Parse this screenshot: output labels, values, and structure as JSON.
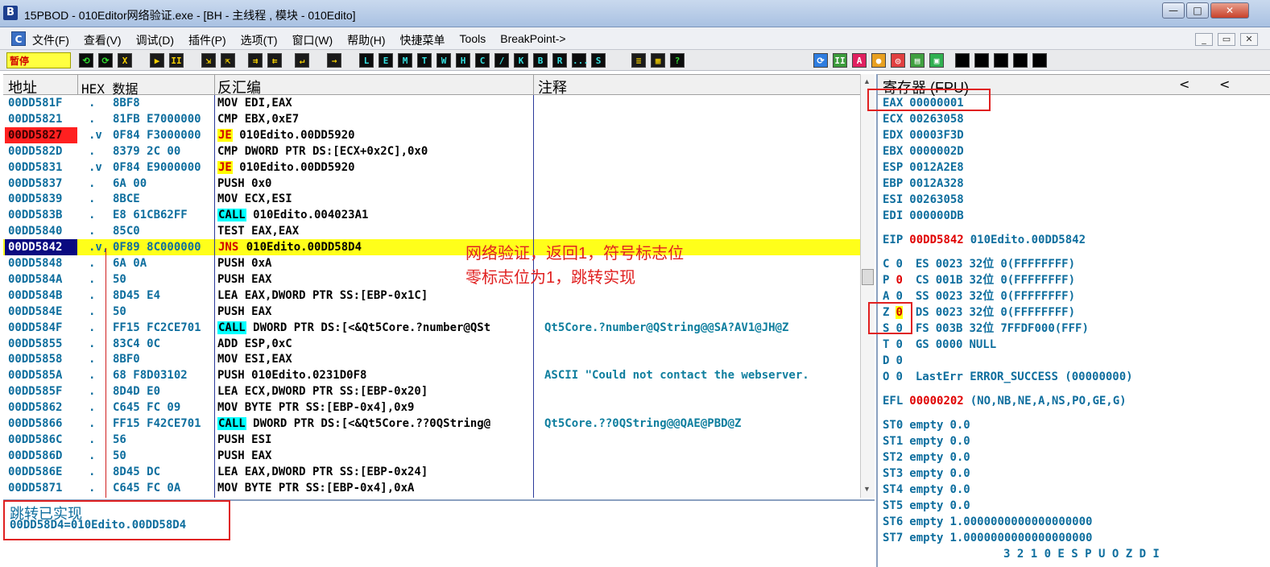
{
  "window": {
    "title": "15PBOD  - 010Editor网络验证.exe - [BH - 主线程 , 模块 - 010Edito]",
    "controls": [
      "—",
      "□",
      "✕"
    ]
  },
  "menu": {
    "items": [
      "文件(F)",
      "查看(V)",
      "调试(D)",
      "插件(P)",
      "选项(T)",
      "窗口(W)",
      "帮助(H)",
      "快捷菜单",
      "Tools",
      "BreakPoint->"
    ],
    "mdi_controls": [
      "_",
      "▭",
      "✕"
    ]
  },
  "toolbar": {
    "status": "暂停",
    "buttons": [
      "⟲",
      "⟳",
      "X",
      "▶",
      "II",
      "⇲",
      "⇱",
      "⇉",
      "⇇",
      "↵",
      "→",
      "L",
      "E",
      "M",
      "T",
      "W",
      "H",
      "C",
      "/",
      "K",
      "B",
      "R",
      "...",
      "S",
      "≡",
      "▦",
      "?"
    ]
  },
  "disasm": {
    "headers": {
      "address": "地址",
      "hex": "HEX 数据",
      "disasm": "反汇编",
      "comment": "注释"
    },
    "rows": [
      {
        "addr": "00DD581F",
        "arrow": ".",
        "hex": "8BF8",
        "op": "",
        "dis": "MOV EDI,EAX",
        "comment": "",
        "type": ""
      },
      {
        "addr": "00DD5821",
        "arrow": ".",
        "hex": "81FB E7000000",
        "op": "",
        "dis": "CMP EBX,0xE7",
        "comment": "",
        "type": ""
      },
      {
        "addr": "00DD5827",
        "arrow": ".v",
        "hex": "0F84 F3000000",
        "op": "JE",
        "dis": " 010Edito.00DD5920",
        "comment": "",
        "type": "bp"
      },
      {
        "addr": "00DD582D",
        "arrow": ".",
        "hex": "8379 2C 00",
        "op": "",
        "dis": "CMP DWORD PTR DS:[ECX+0x2C],0x0",
        "comment": "",
        "type": ""
      },
      {
        "addr": "00DD5831",
        "arrow": ".v",
        "hex": "0F84 E9000000",
        "op": "JE",
        "dis": " 010Edito.00DD5920",
        "comment": "",
        "type": ""
      },
      {
        "addr": "00DD5837",
        "arrow": ".",
        "hex": "6A 00",
        "op": "",
        "dis": "PUSH 0x0",
        "comment": "",
        "type": ""
      },
      {
        "addr": "00DD5839",
        "arrow": ".",
        "hex": "8BCE",
        "op": "",
        "dis": "MOV ECX,ESI",
        "comment": "",
        "type": ""
      },
      {
        "addr": "00DD583B",
        "arrow": ".",
        "hex": "E8 61CB62FF",
        "op": "CALL",
        "dis": " 010Edito.004023A1",
        "comment": "",
        "type": ""
      },
      {
        "addr": "00DD5840",
        "arrow": ".",
        "hex": "85C0",
        "op": "",
        "dis": "TEST EAX,EAX",
        "comment": "",
        "type": ""
      },
      {
        "addr": "00DD5842",
        "arrow": ".v,",
        "hex": "0F89 8C000000",
        "op": "JNS",
        "dis": " 010Edito.00DD58D4",
        "comment": "",
        "type": "eip"
      },
      {
        "addr": "00DD5848",
        "arrow": ".",
        "hex": "6A 0A",
        "op": "",
        "dis": "PUSH 0xA",
        "comment": "",
        "type": ""
      },
      {
        "addr": "00DD584A",
        "arrow": ".",
        "hex": "50",
        "op": "",
        "dis": "PUSH EAX",
        "comment": "",
        "type": ""
      },
      {
        "addr": "00DD584B",
        "arrow": ".",
        "hex": "8D45 E4",
        "op": "",
        "dis": "LEA EAX,DWORD PTR SS:[EBP-0x1C]",
        "comment": "",
        "type": ""
      },
      {
        "addr": "00DD584E",
        "arrow": ".",
        "hex": "50",
        "op": "",
        "dis": "PUSH EAX",
        "comment": "",
        "type": ""
      },
      {
        "addr": "00DD584F",
        "arrow": ".",
        "hex": "FF15 FC2CE701",
        "op": "CALL",
        "dis": " DWORD PTR DS:[<&Qt5Core.?number@QSt",
        "comment": "Qt5Core.?number@QString@@SA?AV1@JH@Z",
        "type": ""
      },
      {
        "addr": "00DD5855",
        "arrow": ".",
        "hex": "83C4 0C",
        "op": "",
        "dis": "ADD ESP,0xC",
        "comment": "",
        "type": ""
      },
      {
        "addr": "00DD5858",
        "arrow": ".",
        "hex": "8BF0",
        "op": "",
        "dis": "MOV ESI,EAX",
        "comment": "",
        "type": ""
      },
      {
        "addr": "00DD585A",
        "arrow": ".",
        "hex": "68 F8D03102",
        "op": "",
        "dis": "PUSH 010Edito.0231D0F8",
        "comment": "ASCII \"Could not contact the webserver.",
        "type": ""
      },
      {
        "addr": "00DD585F",
        "arrow": ".",
        "hex": "8D4D E0",
        "op": "",
        "dis": "LEA ECX,DWORD PTR SS:[EBP-0x20]",
        "comment": "",
        "type": ""
      },
      {
        "addr": "00DD5862",
        "arrow": ".",
        "hex": "C645 FC 09",
        "op": "",
        "dis": "MOV BYTE PTR SS:[EBP-0x4],0x9",
        "comment": "",
        "type": ""
      },
      {
        "addr": "00DD5866",
        "arrow": ".",
        "hex": "FF15 F42CE701",
        "op": "CALL",
        "dis": " DWORD PTR DS:[<&Qt5Core.??0QString@",
        "comment": "Qt5Core.??0QString@@QAE@PBD@Z",
        "type": ""
      },
      {
        "addr": "00DD586C",
        "arrow": ".",
        "hex": "56",
        "op": "",
        "dis": "PUSH ESI",
        "comment": "",
        "type": ""
      },
      {
        "addr": "00DD586D",
        "arrow": ".",
        "hex": "50",
        "op": "",
        "dis": "PUSH EAX",
        "comment": "",
        "type": ""
      },
      {
        "addr": "00DD586E",
        "arrow": ".",
        "hex": "8D45 DC",
        "op": "",
        "dis": "LEA EAX,DWORD PTR SS:[EBP-0x24]",
        "comment": "",
        "type": ""
      },
      {
        "addr": "00DD5871",
        "arrow": ".",
        "hex": "C645 FC 0A",
        "op": "",
        "dis": "MOV BYTE PTR SS:[EBP-0x4],0xA",
        "comment": "",
        "type": ""
      }
    ],
    "annotation": [
      "网络验证，返回1，符号标志位",
      "零标志位为1，跳转实现"
    ]
  },
  "info": {
    "line1": "跳转已实现",
    "line2": "00DD58D4=010Edito.00DD58D4"
  },
  "registers": {
    "title": "寄存器 (FPU)",
    "nav": [
      "<",
      "<"
    ],
    "general": [
      {
        "name": "EAX",
        "value": "00000001"
      },
      {
        "name": "ECX",
        "value": "00263058"
      },
      {
        "name": "EDX",
        "value": "00003F3D"
      },
      {
        "name": "EBX",
        "value": "0000002D"
      },
      {
        "name": "ESP",
        "value": "0012A2E8"
      },
      {
        "name": "EBP",
        "value": "0012A328"
      },
      {
        "name": "ESI",
        "value": "00263058"
      },
      {
        "name": "EDI",
        "value": "000000DB"
      }
    ],
    "eip": {
      "name": "EIP",
      "value": "00DD5842",
      "symbol": "010Edito.00DD5842"
    },
    "flags": [
      {
        "flag": "C",
        "val": "0",
        "seg": "ES",
        "sel": "0023",
        "bits": "32位",
        "base": "0(FFFFFFFF)"
      },
      {
        "flag": "P",
        "val": "0",
        "seg": "CS",
        "sel": "001B",
        "bits": "32位",
        "base": "0(FFFFFFFF)"
      },
      {
        "flag": "A",
        "val": "0",
        "seg": "SS",
        "sel": "0023",
        "bits": "32位",
        "base": "0(FFFFFFFF)"
      },
      {
        "flag": "Z",
        "val": "0",
        "seg": "DS",
        "sel": "0023",
        "bits": "32位",
        "base": "0(FFFFFFFF)"
      },
      {
        "flag": "S",
        "val": "0",
        "seg": "FS",
        "sel": "003B",
        "bits": "32位",
        "base": "7FFDF000(FFF)"
      },
      {
        "flag": "T",
        "val": "0",
        "seg": "GS",
        "sel": "0000",
        "bits": "NULL",
        "base": ""
      },
      {
        "flag": "D",
        "val": "0",
        "seg": "",
        "sel": "",
        "bits": "",
        "base": ""
      }
    ],
    "lasterr": {
      "flag": "O",
      "val": "0",
      "text": "LastErr ERROR_SUCCESS (00000000)"
    },
    "efl": {
      "name": "EFL",
      "value": "00000202",
      "desc": "(NO,NB,NE,A,NS,PO,GE,G)"
    },
    "fpu": [
      {
        "name": "ST0",
        "state": "empty",
        "value": "0.0"
      },
      {
        "name": "ST1",
        "state": "empty",
        "value": "0.0"
      },
      {
        "name": "ST2",
        "state": "empty",
        "value": "0.0"
      },
      {
        "name": "ST3",
        "state": "empty",
        "value": "0.0"
      },
      {
        "name": "ST4",
        "state": "empty",
        "value": "0.0"
      },
      {
        "name": "ST5",
        "state": "empty",
        "value": "0.0"
      },
      {
        "name": "ST6",
        "state": "empty",
        "value": "1.0000000000000000000"
      },
      {
        "name": "ST7",
        "state": "empty",
        "value": "1.0000000000000000000"
      }
    ],
    "fpu_bits_header": "3 2 1 0      E S P U O Z D I"
  },
  "colors": {
    "breakpoint": "#ff2020",
    "eip_row": "#ffff1a",
    "annotation": "#e02020",
    "reg_text": "#0e6e9e"
  }
}
